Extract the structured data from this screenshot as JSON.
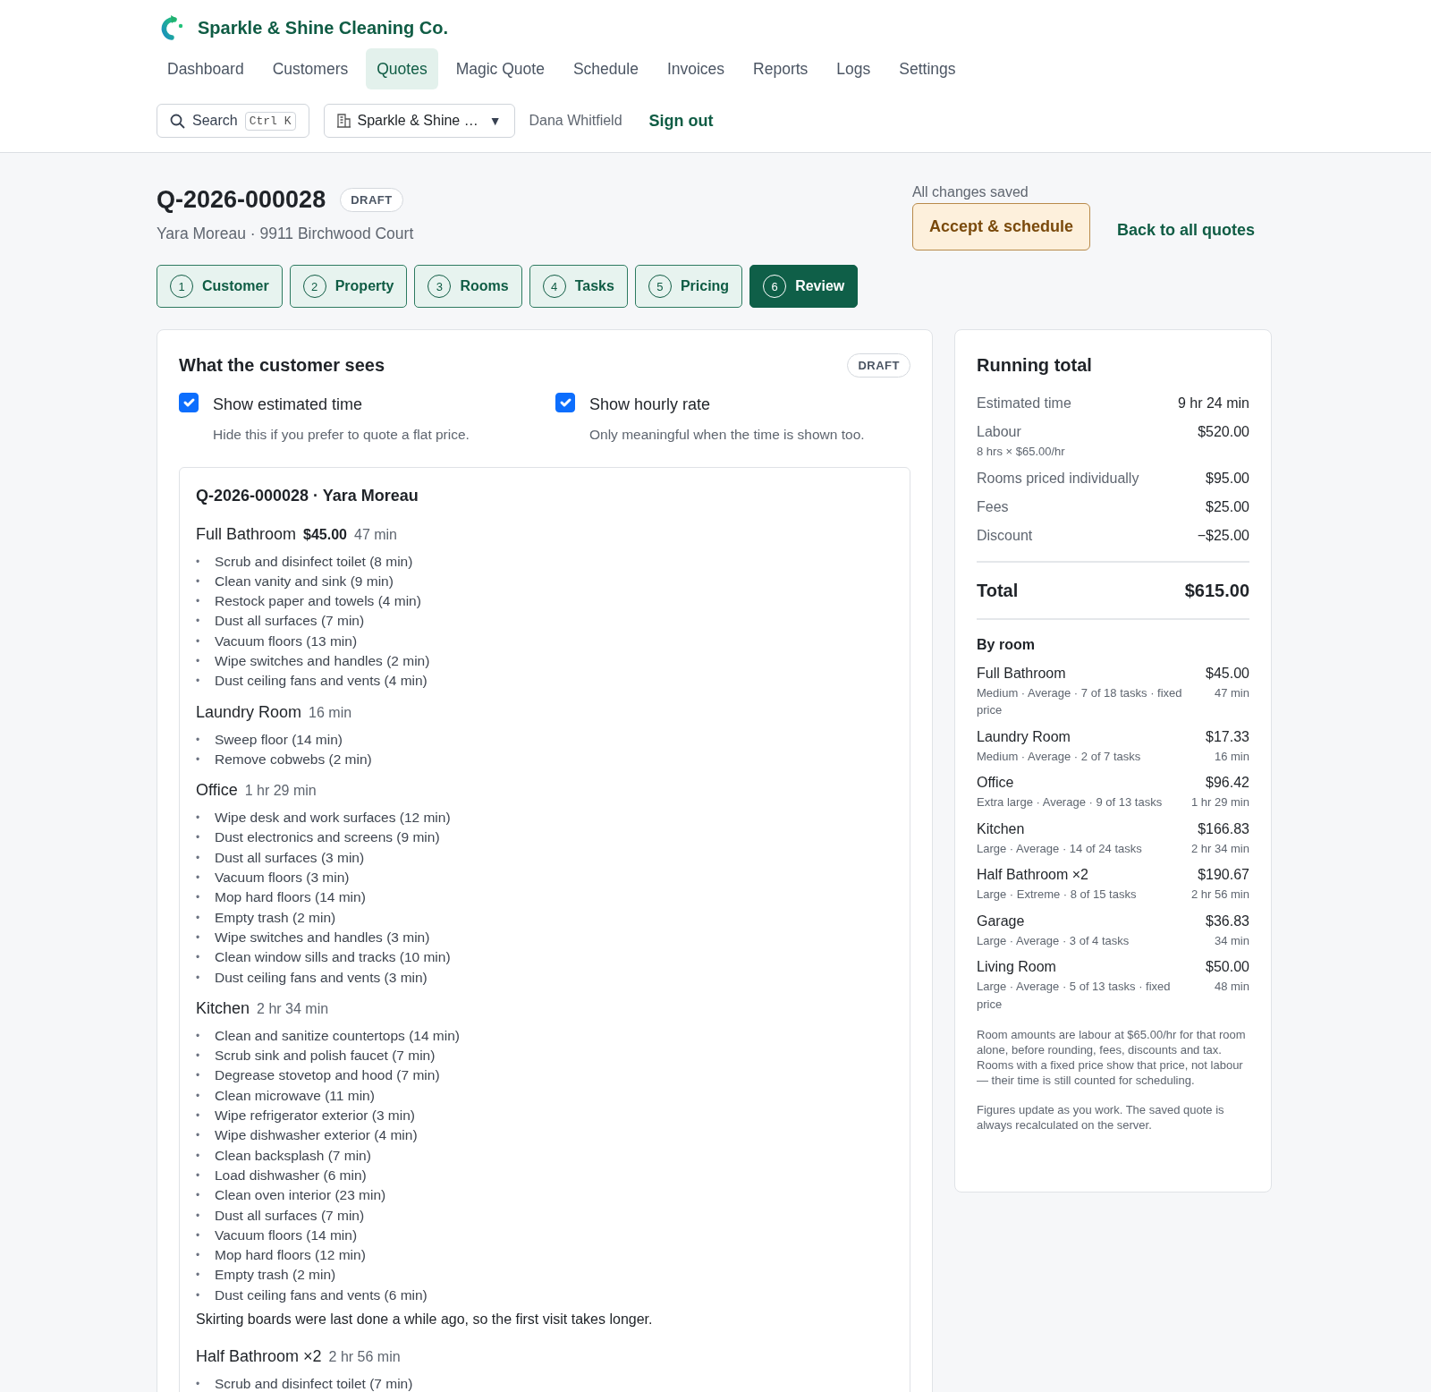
{
  "brand": {
    "name": "Sparkle & Shine Cleaning Co."
  },
  "nav": [
    {
      "label": "Dashboard",
      "selected": false
    },
    {
      "label": "Customers",
      "selected": false
    },
    {
      "label": "Quotes",
      "selected": true
    },
    {
      "label": "Magic Quote",
      "selected": false
    },
    {
      "label": "Schedule",
      "selected": false
    },
    {
      "label": "Invoices",
      "selected": false
    },
    {
      "label": "Reports",
      "selected": false
    },
    {
      "label": "Logs",
      "selected": false
    },
    {
      "label": "Settings",
      "selected": false
    }
  ],
  "search": {
    "label": "Search",
    "shortcut": "Ctrl K"
  },
  "org_select": {
    "value": "Sparkle & Shine …",
    "caret": "▼"
  },
  "user": {
    "name": "Dana Whitfield",
    "sign_out": "Sign out"
  },
  "quote": {
    "number": "Q-2026-000028",
    "status": "DRAFT",
    "subtitle": "Yara Moreau · 9911 Birchwood Court",
    "save_status": "All changes saved",
    "accept": "Accept & schedule",
    "back": "Back to all quotes"
  },
  "steps": [
    {
      "number": "1",
      "label": "Customer",
      "selected": false
    },
    {
      "number": "2",
      "label": "Property",
      "selected": false
    },
    {
      "number": "3",
      "label": "Rooms",
      "selected": false
    },
    {
      "number": "4",
      "label": "Tasks",
      "selected": false
    },
    {
      "number": "5",
      "label": "Pricing",
      "selected": false
    },
    {
      "number": "6",
      "label": "Review",
      "selected": true
    }
  ],
  "customer_view": {
    "title": "What the customer sees",
    "badge": "DRAFT",
    "options": [
      {
        "label": "Show estimated time",
        "hint": "Hide this if you prefer to quote a flat price.",
        "checked": true
      },
      {
        "label": "Show hourly rate",
        "hint": "Only meaningful when the time is shown too.",
        "checked": true
      }
    ],
    "preview": {
      "heading": "Q-2026-000028 · Yara Moreau",
      "bullet": "•",
      "rooms": [
        {
          "name": "Full Bathroom",
          "price": "$45.00",
          "time": "47 min",
          "tasks": [
            "Scrub and disinfect toilet (8 min)",
            "Clean vanity and sink (9 min)",
            "Restock paper and towels (4 min)",
            "Dust all surfaces (7 min)",
            "Vacuum floors (13 min)",
            "Wipe switches and handles (2 min)",
            "Dust ceiling fans and vents (4 min)"
          ]
        },
        {
          "name": "Laundry Room",
          "time": "16 min",
          "tasks": [
            "Sweep floor (14 min)",
            "Remove cobwebs (2 min)"
          ]
        },
        {
          "name": "Office",
          "time": "1 hr 29 min",
          "tasks": [
            "Wipe desk and work surfaces (12 min)",
            "Dust electronics and screens (9 min)",
            "Dust all surfaces (3 min)",
            "Vacuum floors (3 min)",
            "Mop hard floors (14 min)",
            "Empty trash (2 min)",
            "Wipe switches and handles (3 min)",
            "Clean window sills and tracks (10 min)",
            "Dust ceiling fans and vents (3 min)"
          ]
        },
        {
          "name": "Kitchen",
          "time": "2 hr 34 min",
          "tasks": [
            "Clean and sanitize countertops (14 min)",
            "Scrub sink and polish faucet (7 min)",
            "Degrease stovetop and hood (7 min)",
            "Clean microwave (11 min)",
            "Wipe refrigerator exterior (3 min)",
            "Wipe dishwasher exterior (4 min)",
            "Clean backsplash (7 min)",
            "Load dishwasher (6 min)",
            "Clean oven interior (23 min)",
            "Dust all surfaces (7 min)",
            "Vacuum floors (14 min)",
            "Mop hard floors (12 min)",
            "Empty trash (2 min)",
            "Dust ceiling fans and vents (6 min)"
          ],
          "note": "Skirting boards were last done a while ago, so the first visit takes longer."
        },
        {
          "name": "Half Bathroom ×2",
          "time": "2 hr 56 min",
          "tasks": [
            "Scrub and disinfect toilet (7 min)"
          ]
        }
      ]
    }
  },
  "running_total": {
    "title": "Running total",
    "lines": [
      {
        "label": "Estimated time",
        "value": "9 hr 24 min"
      },
      {
        "label": "Labour",
        "detail": "8 hrs × $65.00/hr",
        "value": "$520.00"
      },
      {
        "label": "Rooms priced individually",
        "value": "$95.00"
      },
      {
        "label": "Fees",
        "value": "$25.00"
      },
      {
        "label": "Discount",
        "value": "−$25.00"
      }
    ],
    "total": {
      "label": "Total",
      "value": "$615.00"
    },
    "by_room_title": "By room",
    "rooms": [
      {
        "name": "Full Bathroom",
        "detail": "Medium · Average · 7 of 18 tasks · fixed price",
        "price": "$45.00",
        "time": "47 min"
      },
      {
        "name": "Laundry Room",
        "detail": "Medium · Average · 2 of 7 tasks",
        "price": "$17.33",
        "time": "16 min"
      },
      {
        "name": "Office",
        "detail": "Extra large · Average · 9 of 13 tasks",
        "price": "$96.42",
        "time": "1 hr 29 min"
      },
      {
        "name": "Kitchen",
        "detail": "Large · Average · 14 of 24 tasks",
        "price": "$166.83",
        "time": "2 hr 34 min"
      },
      {
        "name": "Half Bathroom ×2",
        "detail": "Large · Extreme · 8 of 15 tasks",
        "price": "$190.67",
        "time": "2 hr 56 min"
      },
      {
        "name": "Garage",
        "detail": "Large · Average · 3 of 4 tasks",
        "price": "$36.83",
        "time": "34 min"
      },
      {
        "name": "Living Room",
        "detail": "Large · Average · 5 of 13 tasks · fixed price",
        "price": "$50.00",
        "time": "48 min"
      }
    ],
    "notes": [
      "Room amounts are labour at $65.00/hr for that room alone, before rounding, fees, discounts and tax. Rooms with a fixed price show that price, not labour — their time is still counted for scheduling.",
      "Figures update as you work. The saved quote is always recalculated on the server."
    ]
  }
}
